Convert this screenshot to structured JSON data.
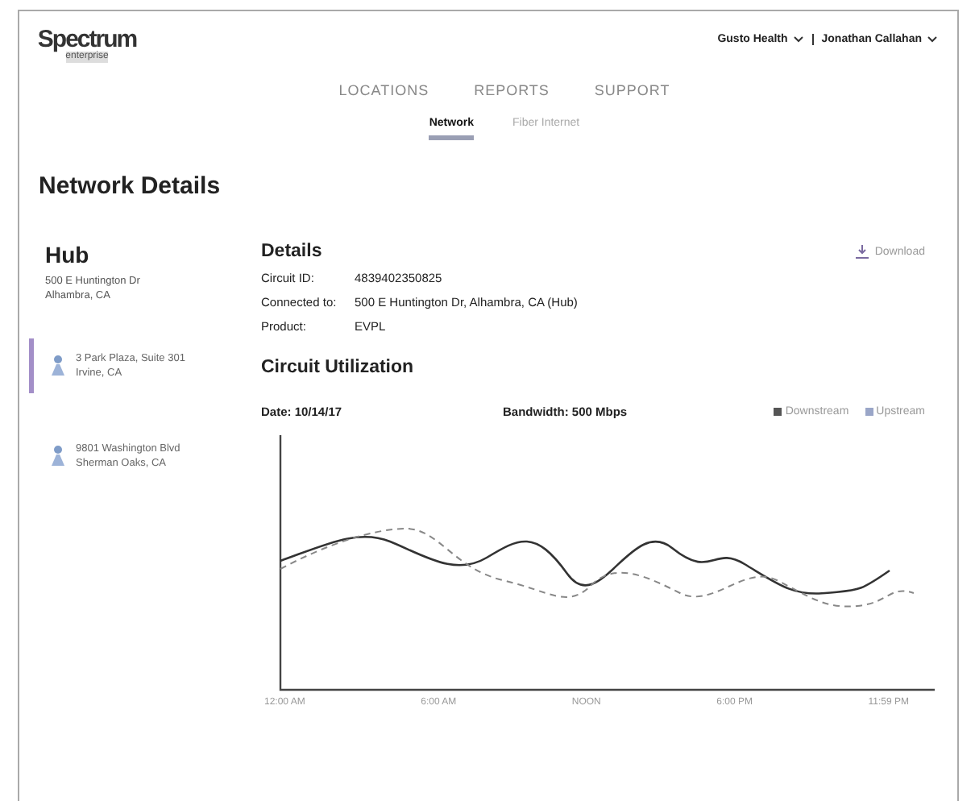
{
  "header": {
    "logo": "Spectrum",
    "logo_sub": "enterprise",
    "account": "Gusto Health",
    "user": "Jonathan Callahan"
  },
  "nav": [
    {
      "label": "LOCATIONS",
      "selected": false
    },
    {
      "label": "REPORTS",
      "selected": false
    },
    {
      "label": "SUPPORT",
      "selected": false
    }
  ],
  "subtabs": [
    {
      "label": "Network",
      "selected": true
    },
    {
      "label": "Fiber Internet",
      "selected": false
    }
  ],
  "page_title": "Network Details",
  "hub": {
    "title": "Hub",
    "address": [
      "500 E Huntington Dr",
      "Alhambra, CA"
    ]
  },
  "locations": [
    {
      "lines": [
        "3 Park Plaza, Suite 301",
        "Irvine, CA"
      ],
      "selected": true
    },
    {
      "lines": [
        "9801 Washington Blvd",
        "Sherman Oaks, CA"
      ],
      "selected": false
    }
  ],
  "details": {
    "title": "Details",
    "download": "Download",
    "rows": [
      {
        "label": "Circuit ID:",
        "value": "4839402350825"
      },
      {
        "label": "Connected to:",
        "value": "500 E Huntington Dr, Alhambra, CA (Hub)"
      },
      {
        "label": "Product:",
        "value": "EVPL"
      }
    ]
  },
  "utilization": {
    "title": "Circuit Utilization",
    "date": "Date: 10/14/17",
    "bandwidth": "Bandwidth: 500 Mbps",
    "legend": [
      {
        "label": "Downstream",
        "color": "#555555"
      },
      {
        "label": "Upstream",
        "color": "#9aa6c8"
      }
    ],
    "x_labels": [
      "12:00 AM",
      "6:00 AM",
      "NOON",
      "6:00 PM",
      "11:59 PM"
    ]
  }
}
